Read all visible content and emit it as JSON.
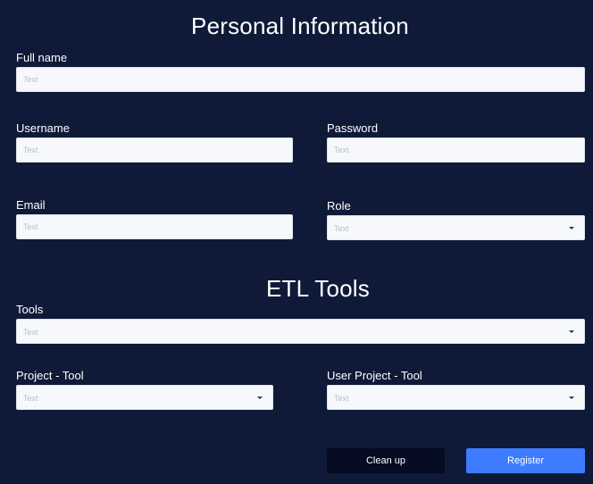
{
  "personal_section": {
    "title": "Personal Information",
    "full_name": {
      "label": "Full name",
      "placeholder": "Text"
    },
    "username": {
      "label": "Username",
      "placeholder": "Text"
    },
    "password": {
      "label": "Password",
      "placeholder": "Text"
    },
    "email": {
      "label": "Email",
      "placeholder": "Text"
    },
    "role": {
      "label": "Role",
      "placeholder": "Text"
    }
  },
  "etl_section": {
    "title": "ETL Tools",
    "tools": {
      "label": "Tools",
      "placeholder": "Text"
    },
    "project_tool": {
      "label": "Project - Tool",
      "placeholder": "Text"
    },
    "user_project_tool": {
      "label": "User Project - Tool",
      "placeholder": "Text"
    }
  },
  "actions": {
    "clean_up_label": "Clean up",
    "register_label": "Register"
  },
  "colors": {
    "background": "#0f1a38",
    "clean_up_button": "#050b22",
    "register_button": "#3d7cff",
    "field_background": "#f6f8fb"
  }
}
